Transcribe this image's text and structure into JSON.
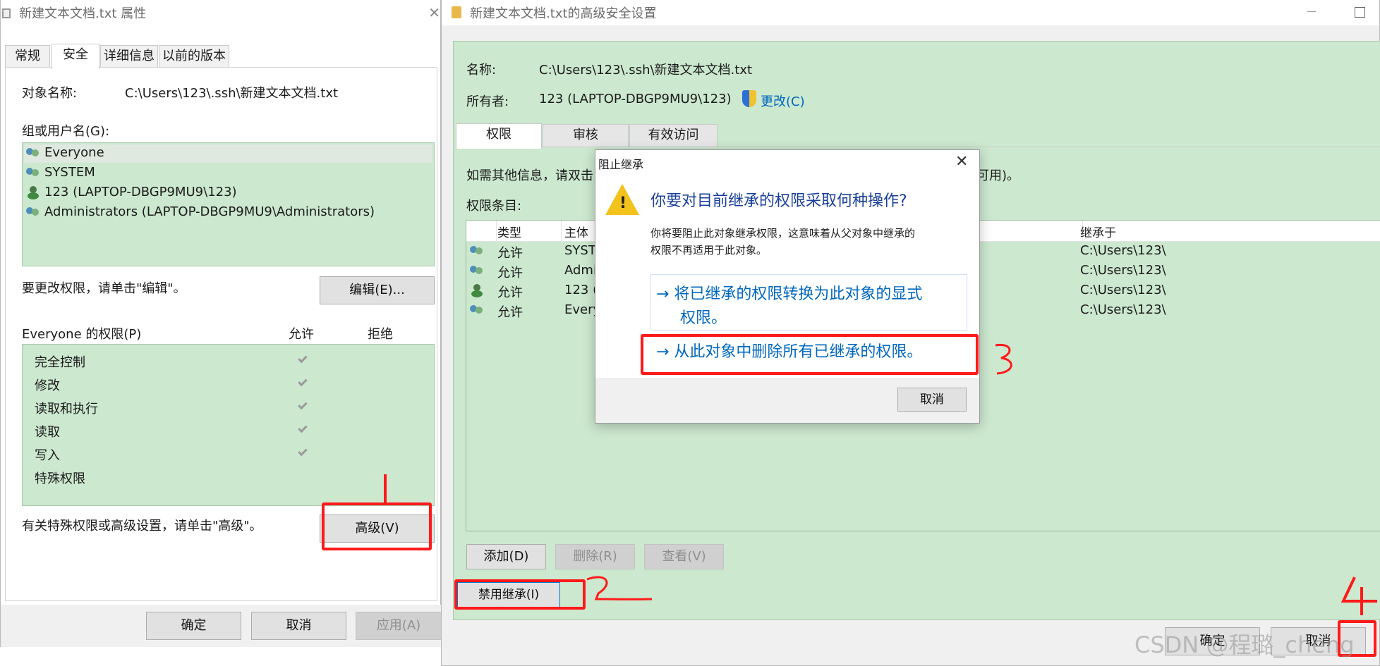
{
  "left": {
    "title": "新建文本文档.txt 属性",
    "tabs": [
      "常规",
      "安全",
      "详细信息",
      "以前的版本"
    ],
    "object_label": "对象名称:",
    "object_value": "C:\\Users\\123\\.ssh\\新建文本文档.txt",
    "group_label": "组或用户名(G):",
    "users": [
      "Everyone",
      "SYSTEM",
      "123 (LAPTOP-DBGP9MU9\\123)",
      "Administrators (LAPTOP-DBGP9MU9\\Administrators)"
    ],
    "edit_hint": "要更改权限，请单击\"编辑\"。",
    "edit_btn": "编辑(E)...",
    "perm_header": "Everyone 的权限(P)",
    "allow": "允许",
    "deny": "拒绝",
    "perms": [
      "完全控制",
      "修改",
      "读取和执行",
      "读取",
      "写入",
      "特殊权限"
    ],
    "adv_hint": "有关特殊权限或高级设置，请单击\"高级\"。",
    "adv_btn": "高级(V)",
    "ok": "确定",
    "cancel": "取消",
    "apply": "应用(A)"
  },
  "right": {
    "title": "新建文本文档.txt的高级安全设置",
    "name_label": "名称:",
    "name_value": "C:\\Users\\123\\.ssh\\新建文本文档.txt",
    "owner_label": "所有者:",
    "owner_value": "123 (LAPTOP-DBGP9MU9\\123)",
    "change_link": "更改(C)",
    "tabs": [
      "权限",
      "审核",
      "有效访问"
    ],
    "info_text": "如需其他信息，请双击",
    "info_tail": "可用)。",
    "entries_label": "权限条目:",
    "columns": [
      "类型",
      "主体",
      "继承于"
    ],
    "rows": [
      {
        "type": "允许",
        "principal": "SYSTE",
        "from": "C:\\Users\\123\\"
      },
      {
        "type": "允许",
        "principal": "Admi",
        "from": "C:\\Users\\123\\"
      },
      {
        "type": "允许",
        "principal": "123 (",
        "from": "C:\\Users\\123\\"
      },
      {
        "type": "允许",
        "principal": "Every",
        "from": "C:\\Users\\123\\"
      }
    ],
    "add_btn": "添加(D)",
    "remove_btn": "删除(R)",
    "view_btn": "查看(V)",
    "disable_btn": "禁用继承(I)",
    "ok": "确定",
    "cancel": "取消"
  },
  "dialog": {
    "title": "阻止继承",
    "heading": "你要对目前继承的权限采取何种操作?",
    "desc1": "你将要阻止此对象继承权限，这意味着从父对象中继承的",
    "desc2": "权限不再适用于此对象。",
    "opt1a": "→ 将已继承的权限转换为此对象的显式",
    "opt1b": "权限。",
    "opt2": "→ 从此对象中删除所有已继承的权限。",
    "cancel": "取消"
  },
  "annotations": {
    "n2": "2",
    "n3": "3",
    "n4": "4"
  },
  "watermark": "CSDN @程璐_cheng",
  "colors": {
    "accent_blue": "#0067c0",
    "annotation_red": "#ff1a1a",
    "panel_green": "#cce8cf"
  }
}
